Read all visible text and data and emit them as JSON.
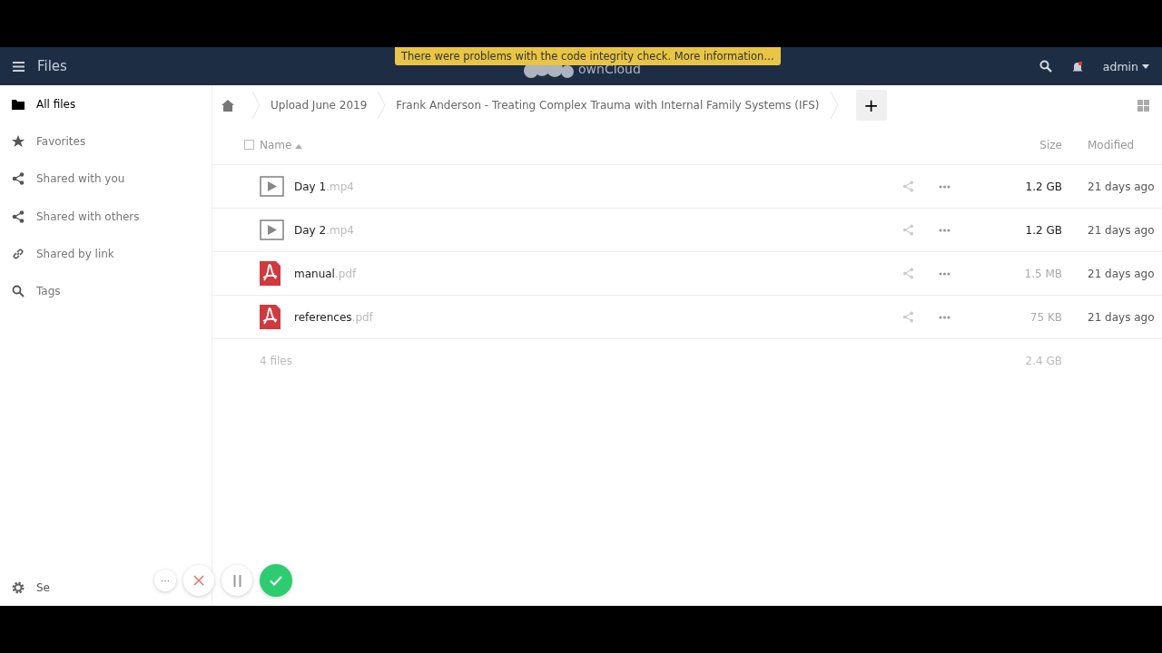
{
  "header": {
    "app_title": "Files",
    "brand": "ownCloud",
    "notice": "There were problems with the code integrity check. More information…",
    "user": "admin",
    "notification_unread": true
  },
  "sidebar": {
    "items": [
      {
        "label": "All files",
        "kind": "folder",
        "selected": true
      },
      {
        "label": "Favorites",
        "kind": "star",
        "selected": false
      },
      {
        "label": "Shared with you",
        "kind": "share",
        "selected": false
      },
      {
        "label": "Shared with others",
        "kind": "share",
        "selected": false
      },
      {
        "label": "Shared by link",
        "kind": "link",
        "selected": false
      },
      {
        "label": "Tags",
        "kind": "search",
        "selected": false
      }
    ],
    "settings": "Se"
  },
  "breadcrumbs": [
    "Upload June 2019",
    "Frank Anderson - Treating Complex Trauma with Internal Family Systems (IFS)"
  ],
  "new_button": "+",
  "table": {
    "select_all_checked": false,
    "columns": [
      "Name",
      "Size",
      "Modified"
    ],
    "rows": [
      {
        "kind": "video",
        "name": "Day 1",
        "ext": ".mp4",
        "size": "1.2 GB",
        "large": true,
        "modified": "21 days ago"
      },
      {
        "kind": "video",
        "name": "Day 2",
        "ext": ".mp4",
        "size": "1.2 GB",
        "large": true,
        "modified": "21 days ago"
      },
      {
        "kind": "pdf",
        "name": "manual",
        "ext": ".pdf",
        "size": "1.5 MB",
        "large": false,
        "modified": "21 days ago"
      },
      {
        "kind": "pdf",
        "name": "references",
        "ext": ".pdf",
        "size": "75 KB",
        "large": false,
        "modified": "21 days ago"
      }
    ],
    "summary": {
      "count": "4 files",
      "size": "2.4 GB"
    }
  },
  "recorder": {
    "more": "···"
  }
}
